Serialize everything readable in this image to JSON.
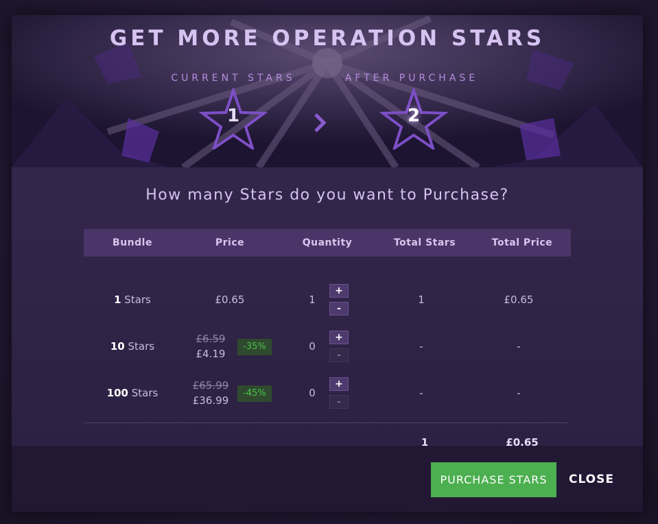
{
  "header": {
    "title": "GET MORE OPERATION STARS",
    "current_label": "CURRENT STARS",
    "after_label": "AFTER PURCHASE",
    "current_value": "1",
    "after_value": "2"
  },
  "question": "How many Stars do you want to Purchase?",
  "table": {
    "columns": [
      "Bundle",
      "Price",
      "Quantity",
      "Total Stars",
      "Total Price"
    ],
    "rows": [
      {
        "bundle_count": "1",
        "bundle_unit": " Stars",
        "price_old": "",
        "price": "£0.65",
        "discount": "",
        "quantity": "1",
        "total_stars": "1",
        "total_price": "£0.65"
      },
      {
        "bundle_count": "10",
        "bundle_unit": " Stars",
        "price_old": "£6.59",
        "price": "£4.19",
        "discount": "-35%",
        "quantity": "0",
        "total_stars": "-",
        "total_price": "-"
      },
      {
        "bundle_count": "100",
        "bundle_unit": " Stars",
        "price_old": "£65.99",
        "price": "£36.99",
        "discount": "-45%",
        "quantity": "0",
        "total_stars": "-",
        "total_price": "-"
      }
    ],
    "plus_label": "+",
    "minus_label": "-",
    "totals": {
      "stars": "1",
      "price": "£0.65"
    }
  },
  "footer": {
    "purchase_label": "PURCHASE STARS",
    "close_label": "CLOSE"
  },
  "icons": {
    "star": "star-outline-icon",
    "chevron": "chevron-right-icon"
  },
  "colors": {
    "accent": "#7a4fc0",
    "purchase": "#4caf50",
    "discount_text": "#4fc24a"
  }
}
